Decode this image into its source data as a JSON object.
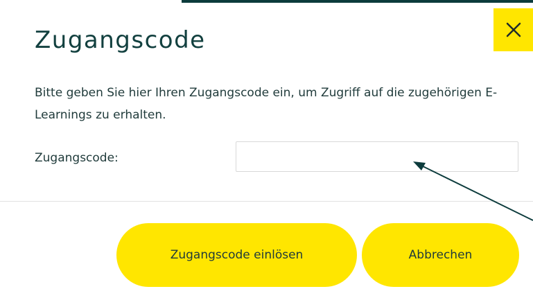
{
  "dialog": {
    "title": "Zugangscode",
    "description": "Bitte geben Sie hier Ihren Zugangscode ein, um Zugriff auf die zugehörigen E-Learnings zu erhalten.",
    "field_label": "Zugangscode:",
    "code_input": {
      "value": "",
      "placeholder": ""
    },
    "buttons": {
      "redeem_label": "Zugangscode einlösen",
      "cancel_label": "Abbrechen"
    },
    "close_icon": "close-icon"
  },
  "colors": {
    "accent_yellow": "#ffe600",
    "dark_teal": "#0c3b3c",
    "text": "#1f3a3a",
    "arrow": "#0c3b3c"
  }
}
